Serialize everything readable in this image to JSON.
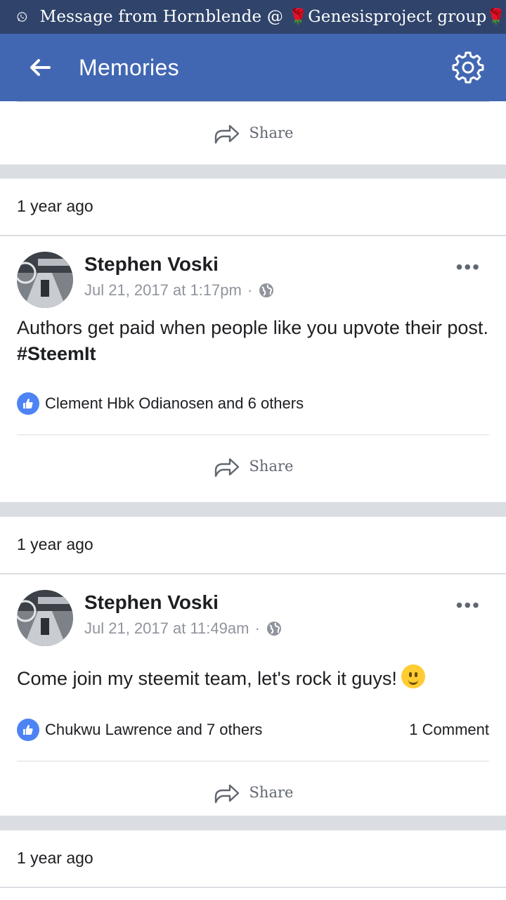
{
  "status_bar": {
    "message_prefix": "Message from Hornblende @",
    "rose": "🌹",
    "group": "Genesisproject group",
    "rose_end": "🌹"
  },
  "app_bar": {
    "title": "Memories"
  },
  "top_card": {
    "share_label": "Share"
  },
  "memories": [
    {
      "ago": "1 year ago",
      "author": "Stephen Voski",
      "timestamp": "Jul 21, 2017 at 1:17pm",
      "text_plain": "Authors get paid when people like you upvote their post. ",
      "text_bold": "#SteemIt",
      "likes": "Clement Hbk Odianosen and 6 others",
      "share_label": "Share"
    },
    {
      "ago": "1 year ago",
      "author": "Stephen Voski",
      "timestamp": "Jul 21, 2017 at 11:49am",
      "text_plain": "Come join my steemit team, let's rock it guys!",
      "likes": "Chukwu Lawrence and 7 others",
      "comments": "1 Comment",
      "share_label": "Share"
    }
  ],
  "bottom_card": {
    "ago": "1 year ago"
  },
  "colors": {
    "app_bar": "#4267b2",
    "status_bar": "#30446b",
    "like": "#4e83f4"
  }
}
